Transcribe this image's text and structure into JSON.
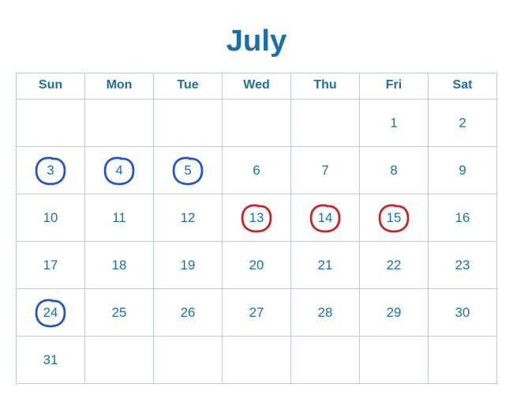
{
  "title": "July",
  "weekdays": [
    "Sun",
    "Mon",
    "Tue",
    "Wed",
    "Thu",
    "Fri",
    "Sat"
  ],
  "weeks": [
    [
      {
        "day": "",
        "circle": "none"
      },
      {
        "day": "",
        "circle": "none"
      },
      {
        "day": "",
        "circle": "none"
      },
      {
        "day": "",
        "circle": "none"
      },
      {
        "day": "",
        "circle": "none"
      },
      {
        "day": "1",
        "circle": "none"
      },
      {
        "day": "2",
        "circle": "none"
      }
    ],
    [
      {
        "day": "3",
        "circle": "blue"
      },
      {
        "day": "4",
        "circle": "blue"
      },
      {
        "day": "5",
        "circle": "blue"
      },
      {
        "day": "6",
        "circle": "none"
      },
      {
        "day": "7",
        "circle": "none"
      },
      {
        "day": "8",
        "circle": "none"
      },
      {
        "day": "9",
        "circle": "none"
      }
    ],
    [
      {
        "day": "10",
        "circle": "none"
      },
      {
        "day": "11",
        "circle": "none"
      },
      {
        "day": "12",
        "circle": "none"
      },
      {
        "day": "13",
        "circle": "red"
      },
      {
        "day": "14",
        "circle": "red"
      },
      {
        "day": "15",
        "circle": "red"
      },
      {
        "day": "16",
        "circle": "none"
      }
    ],
    [
      {
        "day": "17",
        "circle": "none"
      },
      {
        "day": "18",
        "circle": "none"
      },
      {
        "day": "19",
        "circle": "none"
      },
      {
        "day": "20",
        "circle": "none"
      },
      {
        "day": "21",
        "circle": "none"
      },
      {
        "day": "22",
        "circle": "none"
      },
      {
        "day": "23",
        "circle": "none"
      }
    ],
    [
      {
        "day": "24",
        "circle": "blue"
      },
      {
        "day": "25",
        "circle": "none"
      },
      {
        "day": "26",
        "circle": "none"
      },
      {
        "day": "27",
        "circle": "none"
      },
      {
        "day": "28",
        "circle": "none"
      },
      {
        "day": "29",
        "circle": "none"
      },
      {
        "day": "30",
        "circle": "none"
      }
    ],
    [
      {
        "day": "31",
        "circle": "none"
      },
      {
        "day": "",
        "circle": "none"
      },
      {
        "day": "",
        "circle": "none"
      },
      {
        "day": "",
        "circle": "none"
      },
      {
        "day": "",
        "circle": "none"
      },
      {
        "day": "",
        "circle": "none"
      },
      {
        "day": "",
        "circle": "none"
      }
    ]
  ],
  "colors": {
    "blue_circle": "#2255cc",
    "red_circle": "#cc2222",
    "header_text": "#1a6fa8",
    "day_text": "#1a6fa8"
  }
}
